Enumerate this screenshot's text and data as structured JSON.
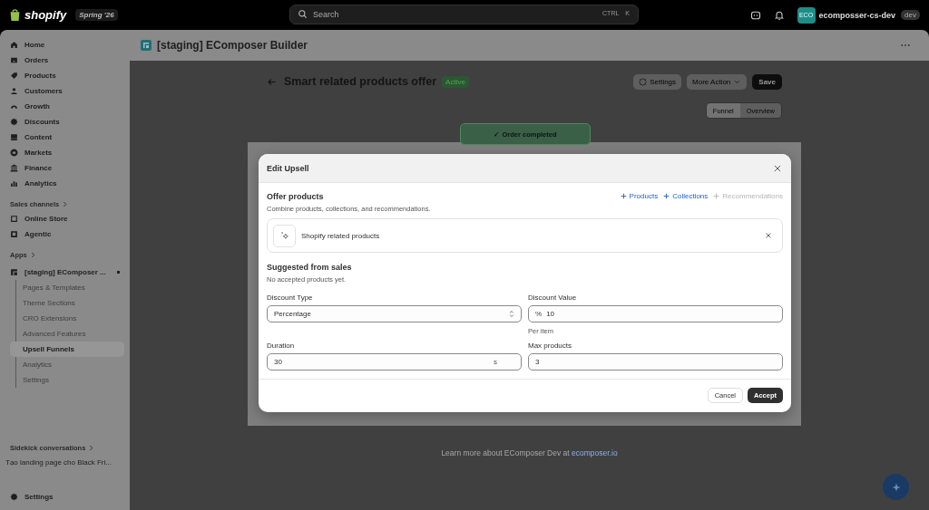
{
  "top_bar": {
    "logo": "shopify",
    "edition": "Spring '26",
    "search": {
      "placeholder": "Search",
      "shortcut": [
        "CTRL",
        "K"
      ]
    },
    "store": {
      "initials": "ECO",
      "name": "ecomposser-cs-dev",
      "badge": "dev"
    }
  },
  "sidebar": {
    "items": [
      {
        "label": "Home",
        "selected": false
      },
      {
        "label": "Orders",
        "selected": false
      },
      {
        "label": "Products",
        "selected": false
      },
      {
        "label": "Customers",
        "selected": false
      },
      {
        "label": "Growth",
        "selected": false
      },
      {
        "label": "Discounts",
        "selected": false
      },
      {
        "label": "Content",
        "selected": false
      },
      {
        "label": "Markets",
        "selected": false
      },
      {
        "label": "Finance",
        "selected": false
      },
      {
        "label": "Analytics",
        "selected": false
      }
    ],
    "sales_channels": {
      "heading": "Sales channels",
      "items": [
        {
          "label": "Online Store",
          "selected": false
        },
        {
          "label": "Agentic",
          "selected": false
        }
      ]
    },
    "apps": {
      "heading": "Apps",
      "app": {
        "label": "[staging] EComposer ...",
        "children": [
          {
            "label": "Pages & Templates",
            "selected": false
          },
          {
            "label": "Theme Sections",
            "selected": false
          },
          {
            "label": "CRO Extensions",
            "selected": false
          },
          {
            "label": "Advanced Features",
            "selected": false
          },
          {
            "label": "Upsell Funnels",
            "selected": true
          },
          {
            "label": "Analytics",
            "selected": false
          },
          {
            "label": "Settings",
            "selected": false
          }
        ]
      }
    },
    "sidekick": {
      "heading": "Sidekick conversations",
      "items": [
        "Tạo landing page cho Black Fri..."
      ]
    },
    "settings": "Settings"
  },
  "app_header": {
    "title": "[staging] EComposer Builder"
  },
  "page": {
    "title": "Smart related products offer",
    "status": "Active",
    "settings": "Settings",
    "more": "More Action",
    "save": "Save",
    "view_tabs": [
      {
        "label": "Funnel",
        "selected": true
      },
      {
        "label": "Overview",
        "selected": false
      }
    ],
    "funnel_node": "✓ Order completed",
    "footer": {
      "text": "Learn more about EComposer Dev at",
      "link": "ecomposer.io"
    }
  },
  "modal": {
    "title": "Edit Upsell",
    "section": "Offer products",
    "description": "Combine products, collections, and recommendations.",
    "add_links": [
      {
        "label": "Products",
        "disabled": false
      },
      {
        "label": "Collections",
        "disabled": false
      },
      {
        "label": "Recommendations",
        "disabled": true
      }
    ],
    "offer_item": "Shopify related products",
    "suggested_heading": "Suggested from sales",
    "suggested_empty": "No accepted products yet.",
    "fields": [
      {
        "label": "Discount Type",
        "kind": "select",
        "value": "Percentage"
      },
      {
        "label": "Discount Value",
        "kind": "input",
        "prefix": "%",
        "value": "10",
        "help": "Per item"
      },
      {
        "label": "Duration",
        "kind": "input",
        "value": "30",
        "suffix": "s"
      },
      {
        "label": "Max products",
        "kind": "input",
        "value": "3"
      }
    ],
    "cancel": "Cancel",
    "accept": "Accept"
  }
}
